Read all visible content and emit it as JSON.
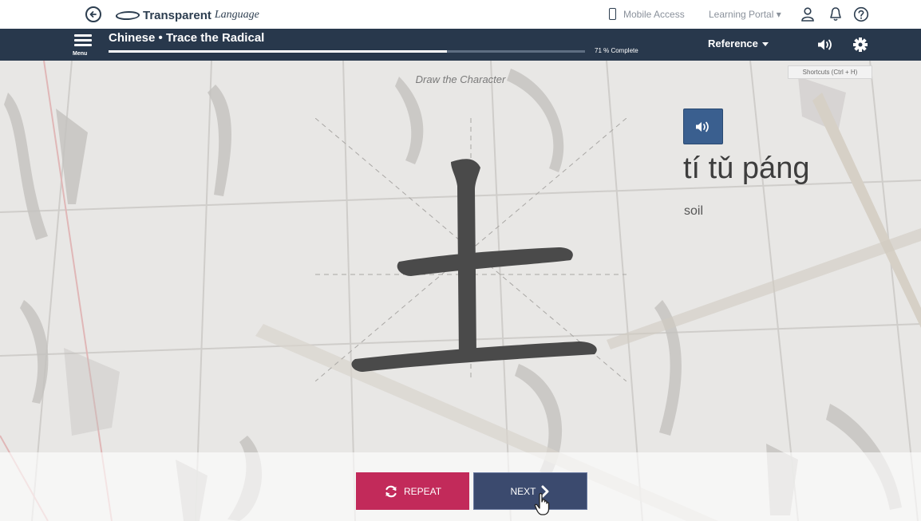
{
  "topbar": {
    "logo_bold": "Transparent",
    "logo_italic": "Language",
    "mobile_access": "Mobile Access",
    "learning_portal": "Learning Portal ▾"
  },
  "header": {
    "menu_label": "Menu",
    "title": "Chinese • Trace the Radical",
    "progress_percent": 71,
    "progress_label": "71 % Complete",
    "reference_label": "Reference"
  },
  "main": {
    "shortcuts": "Shortcuts (Ctrl + H)",
    "instruction": "Draw the Character",
    "character": "土",
    "pinyin": "tí tǔ páng",
    "meaning": "soil"
  },
  "footer": {
    "repeat_label": "REPEAT",
    "next_label": "NEXT"
  },
  "colors": {
    "header_bg": "#28384c",
    "repeat_bg": "#c22a5a",
    "next_bg": "#3b4a6e",
    "audio_bg": "#3a5f8f",
    "character": "#4a4a4a"
  },
  "icons": [
    "back-arrow-icon",
    "logo-icon",
    "phone-icon",
    "user-icon",
    "bell-icon",
    "help-icon",
    "menu-icon",
    "speaker-icon",
    "gear-icon",
    "refresh-icon",
    "chevron-right-icon",
    "hand-cursor-icon"
  ]
}
